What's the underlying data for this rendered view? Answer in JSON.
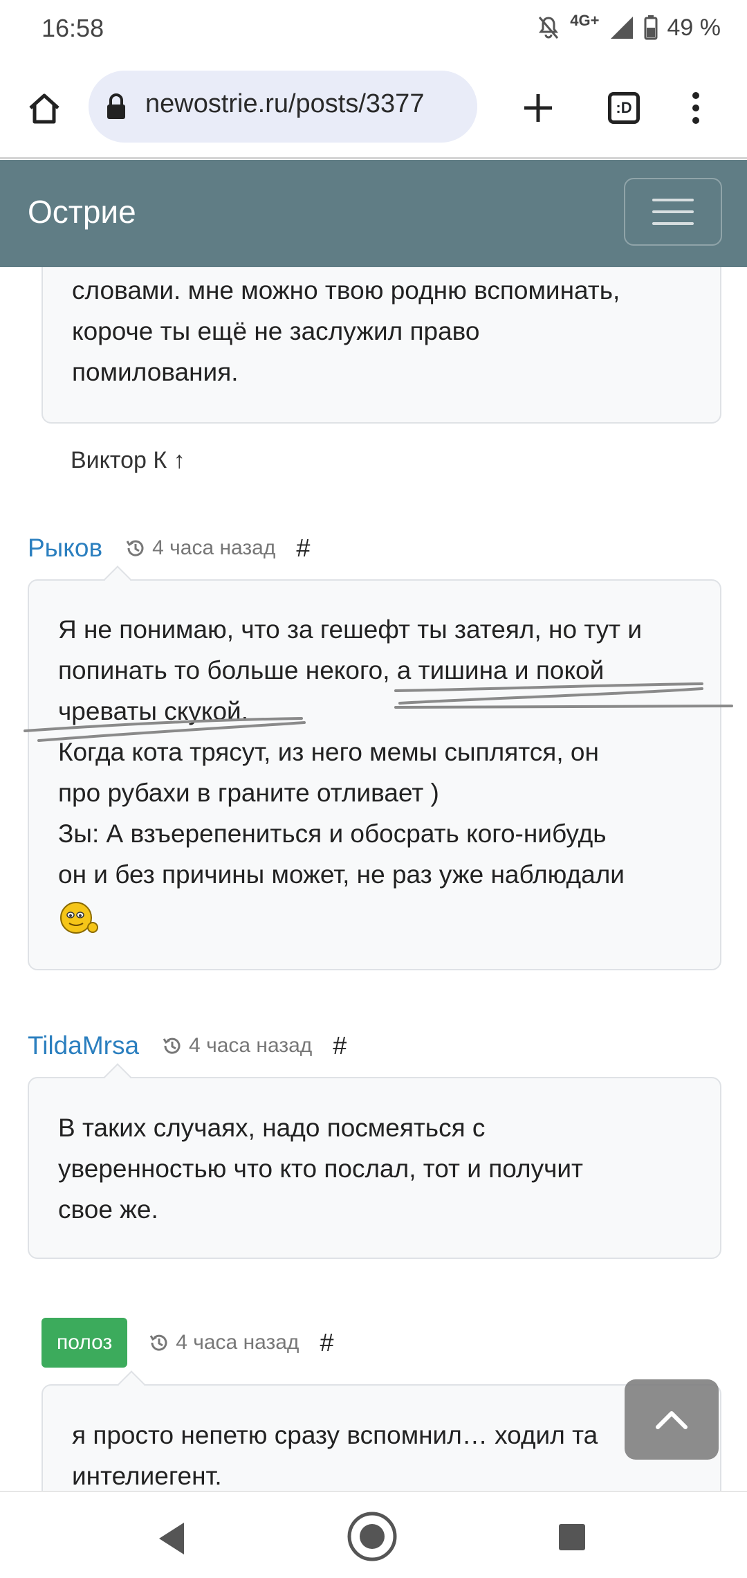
{
  "status_bar": {
    "time": "16:58",
    "network": "4G+",
    "battery": "49 %",
    "icons": [
      "mute-bell-icon",
      "signal-icon",
      "battery-icon"
    ]
  },
  "browser": {
    "url": "newostrie.ru/posts/3377",
    "tabs_label": ":D",
    "icons": [
      "home-icon",
      "lock-icon",
      "plus-icon",
      "tabs-icon",
      "more-vert-icon"
    ]
  },
  "site": {
    "brand": "Острие"
  },
  "posts": {
    "prev_card_lines": [
      "словами. мне можно твою родню вспоминать,",
      "короче ты ещё не заслужил право",
      "помилования."
    ],
    "reply_link": "Виктор К ↑",
    "comment1": {
      "author": "Рыков",
      "time": "4 часа назад",
      "hash": "#",
      "lines": [
        "Я не понимаю, что за гешефт ты затеял, но тут и",
        "попинать то больше некого, а тишина и покой",
        "чреваты скукой.",
        "Когда кота трясут, из него мемы сыплятся, он",
        "про рубахи в граните отливает )",
        "Зы: А взъерепениться и обосрать кого-нибудь",
        "он и без причины может, не раз уже наблюдали"
      ],
      "emoji": "smiley-icon"
    },
    "comment2": {
      "author": "TildaMrsa",
      "time": "4 часа назад",
      "hash": "#",
      "lines": [
        "В таких случаях, надо посмеяться с",
        "уверенностью что кто послал, тот и получит",
        "свое же."
      ]
    },
    "comment3": {
      "author": "полоз",
      "time": "4 часа назад",
      "hash": "#",
      "lines": [
        "я просто непетю сразу вспомнил… ходил та",
        "интелиегент."
      ]
    }
  },
  "colors": {
    "navbar": "#607d85",
    "author_link": "#2b7fbf",
    "badge_green": "#3cab5c"
  }
}
